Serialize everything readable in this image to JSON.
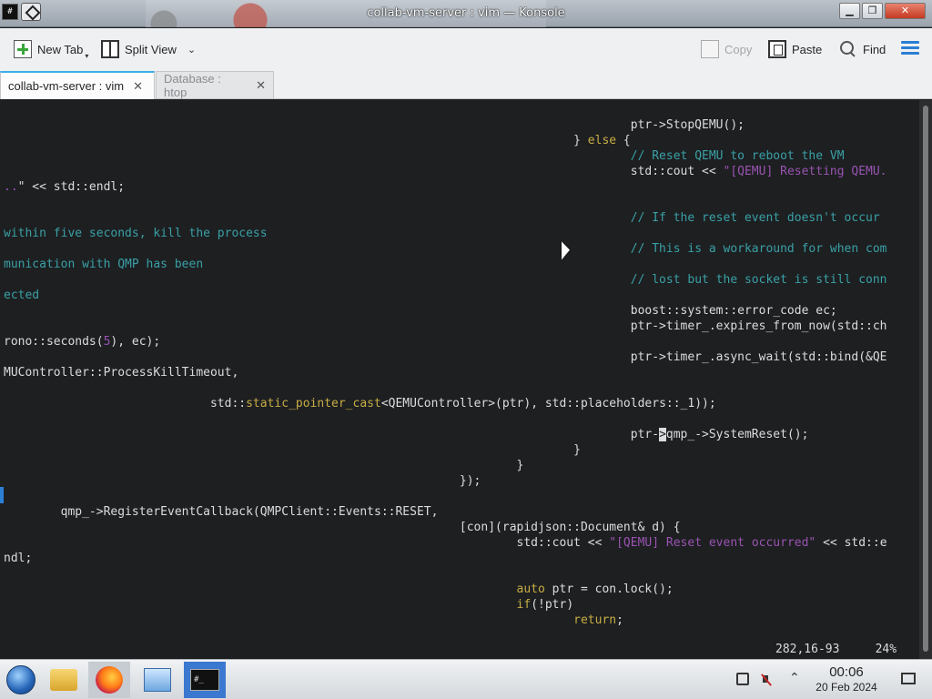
{
  "window": {
    "title": "collab-vm-server : vim — Konsole",
    "app_icon_text": "#",
    "controls": {
      "minimize": "▁",
      "maximize": "❐",
      "close": "✕"
    }
  },
  "toolbar": {
    "new_tab": "New Tab",
    "split_view": "Split View",
    "copy": "Copy",
    "paste": "Paste",
    "find": "Find"
  },
  "tabs": [
    {
      "label": "collab-vm-server : vim",
      "active": true
    },
    {
      "label": "Database : htop",
      "active": false
    }
  ],
  "terminal": {
    "status_position": "282,16-93",
    "status_percent": "24%"
  },
  "taskbar": {
    "clock_time": "00:06",
    "clock_date": "20 Feb 2024",
    "konsole_icon_text": "#_"
  }
}
